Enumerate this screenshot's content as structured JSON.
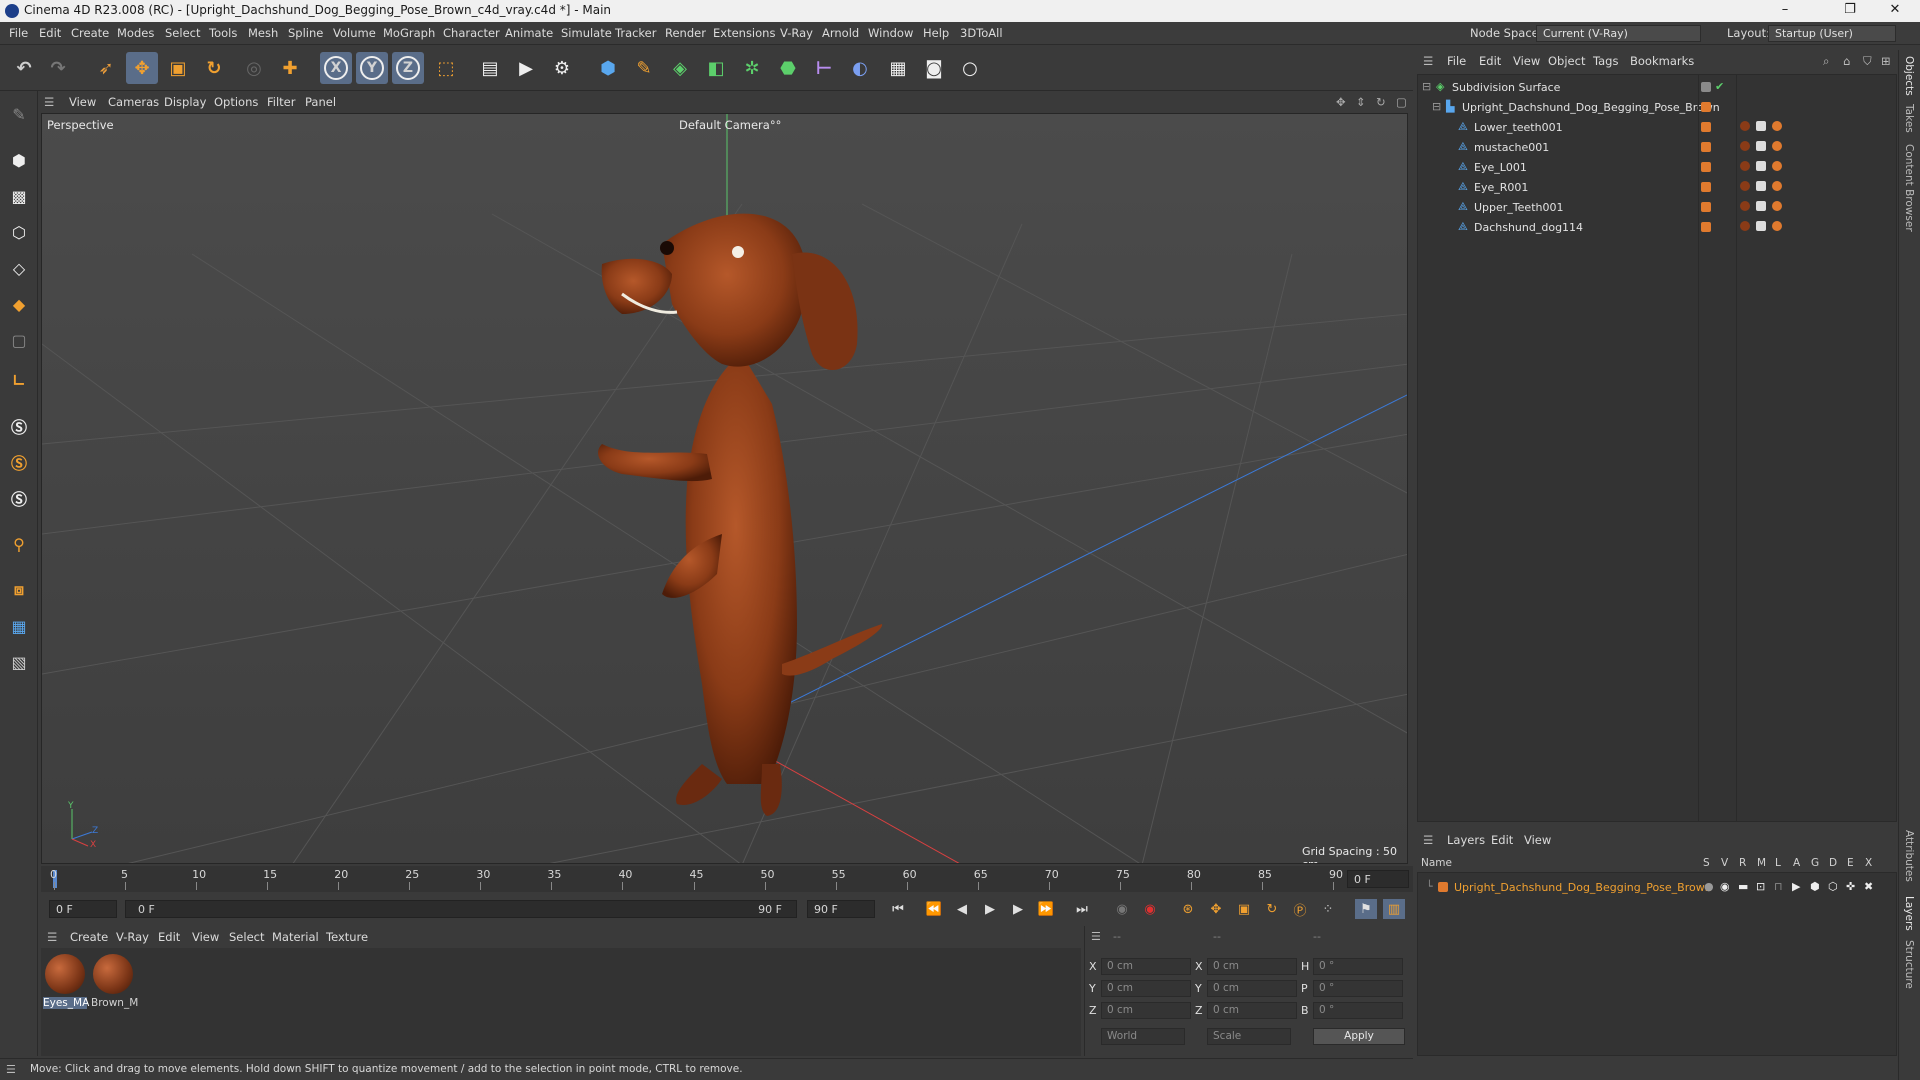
{
  "window": {
    "title": "Cinema 4D R23.008 (RC) - [Upright_Dachshund_Dog_Begging_Pose_Brown_c4d_vray.c4d *] - Main",
    "minimize": "–",
    "maximize": "❐",
    "close": "✕"
  },
  "menubar": {
    "items": [
      "File",
      "Edit",
      "Create",
      "Modes",
      "Select",
      "Tools",
      "Mesh",
      "Spline",
      "Volume",
      "MoGraph",
      "Character",
      "Animate",
      "Simulate",
      "Tracker",
      "Render",
      "Extensions",
      "V-Ray",
      "Arnold",
      "Window",
      "Help",
      "3DToAll"
    ],
    "node_space_label": "Node Space:",
    "node_space_value": "Current (V-Ray)",
    "layout_label": "Layout:",
    "layout_value": "Startup (User)"
  },
  "toolbar": {
    "axis_x": "X",
    "axis_y": "Y",
    "axis_z": "Z"
  },
  "viewport": {
    "menu": [
      "View",
      "Cameras",
      "Display",
      "Options",
      "Filter",
      "Panel"
    ],
    "label": "Perspective",
    "camera": "Default Camera",
    "camera_suffix": "°°",
    "grid_spacing": "Grid Spacing : 50 cm",
    "axis_y": "Y",
    "axis_z": "Z",
    "axis_x": "X"
  },
  "timeline": {
    "ticks": [
      "0",
      "5",
      "10",
      "15",
      "20",
      "25",
      "30",
      "35",
      "40",
      "45",
      "50",
      "55",
      "60",
      "65",
      "70",
      "75",
      "80",
      "85",
      "90"
    ],
    "current_frame": "0 F",
    "start_frame": "0 F",
    "range_start": "0 F",
    "range_end": "90 F",
    "end_frame": "90 F"
  },
  "material_manager": {
    "menu": [
      "Create",
      "V-Ray",
      "Edit",
      "View",
      "Select",
      "Material",
      "Texture"
    ],
    "materials": [
      {
        "name": "Eyes_MA"
      },
      {
        "name": "Brown_M"
      }
    ]
  },
  "coordinates": {
    "header": [
      "--",
      "--",
      "--"
    ],
    "rows": [
      {
        "l1": "X",
        "v1": "0 cm",
        "l2": "X",
        "v2": "0 cm",
        "l3": "H",
        "v3": "0 °"
      },
      {
        "l1": "Y",
        "v1": "0 cm",
        "l2": "Y",
        "v2": "0 cm",
        "l3": "P",
        "v3": "0 °"
      },
      {
        "l1": "Z",
        "v1": "0 cm",
        "l2": "Z",
        "v2": "0 cm",
        "l3": "B",
        "v3": "0 °"
      }
    ],
    "world": "World",
    "scale": "Scale",
    "apply": "Apply"
  },
  "status": "Move: Click and drag to move elements. Hold down SHIFT to quantize movement / add to the selection in point mode, CTRL to remove.",
  "object_manager": {
    "menu": [
      "File",
      "Edit",
      "View",
      "Object",
      "Tags",
      "Bookmarks"
    ],
    "objects": [
      {
        "name": "Subdivision Surface"
      },
      {
        "name": "Upright_Dachshund_Dog_Begging_Pose_Brown"
      },
      {
        "name": "Lower_teeth001"
      },
      {
        "name": "mustache001"
      },
      {
        "name": "Eye_L001"
      },
      {
        "name": "Eye_R001"
      },
      {
        "name": "Upper_Teeth001"
      },
      {
        "name": "Dachshund_dog114"
      }
    ]
  },
  "layers": {
    "menu": [
      "Layers",
      "Edit",
      "View"
    ],
    "name_header": "Name",
    "flags": [
      "S",
      "V",
      "R",
      "M",
      "L",
      "A",
      "G",
      "D",
      "E",
      "X"
    ],
    "items": [
      {
        "name": "Upright_Dachshund_Dog_Begging_Pose_Brown"
      }
    ]
  },
  "side_tabs": [
    "Objects",
    "Takes",
    "Content Browser",
    "Attributes",
    "Layers",
    "Structure"
  ],
  "colors": {
    "accent_orange": "#e07a2e",
    "layer_text": "#f0a030",
    "selection_blue": "#5a6d89"
  }
}
